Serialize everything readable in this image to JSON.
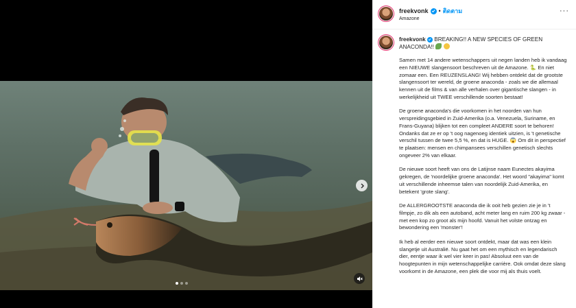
{
  "header": {
    "username": "freekvonk",
    "separator": "•",
    "follow_label": "ติดตาม",
    "location": "Amazone",
    "more_label": "···"
  },
  "caption": {
    "username": "freekvonk",
    "headline": "BREAKING!! A NEW SPECIES OF GREEN ANACONDA!!",
    "paragraphs": [
      "Samen met 14 andere wetenschappers uit negen landen heb ik vandaag een NIEUWE slangensoort beschreven uit de Amazone. 🐍 En niet zomaar een. Een REUZENSLANG! Wij hebben ontdekt dat de grootste slangensoort ter wereld, de groene anaconda - zoals we die allemaal kennen uit de films & van alle verhalen over gigantische slangen - in werkelijkheid uit TWEE verschillende soorten bestaat!",
      "De groene anaconda's die voorkomen in het noorden van hun verspreidingsgebied in Zuid-Amerika (o.a. Venezuela, Suriname, en Frans-Guyana) blijken tot een compleet ANDERE soort te behoren! Ondanks dat ze er op 't oog nagenoeg identiek uitzien, is 't genetische verschil tussen de twee 5,5 %, en dat is HUGE. 😱 Om dit in perspectief te plaatsen: mensen en chimpansees verschillen genetisch slechts ongeveer 2% van elkaar.",
      "De nieuwe soort heeft van ons de Latijnse naam Eunectes akayima gekregen, de 'noordelijke groene anaconda'. Het woord \"akayima\" komt uit verschillende inheemse talen van noordelijk Zuid-Amerika, en betekent 'grote slang'.",
      "De ALLERGROOTSTE anaconda die ik ooit heb gezien zie je in 't filmpje, zo dik als een autoband, acht meter lang en ruim 200 kg zwaar - met een kop zo groot als mijn hoofd. Vanuit het volste ontzag en bewondering een 'monster'!",
      "Ik heb al eerder een nieuwe soort ontdekt, maar dat was een klein slangetje uit Australië. Nu gaat het om een mythisch en legendarisch dier, eentje waar ik wel vier keer in pas! Absoluut een van de hoogtepunten in mijn wetenschappelijke carrière. Ook omdat deze slang voorkomt in de Amazone, een plek die voor mij als thuis voelt."
    ]
  },
  "media": {
    "carousel_total": 3,
    "carousel_active": 1
  },
  "colors": {
    "link_blue": "#0095f6",
    "verified_blue": "#0095f6",
    "text": "#262626"
  }
}
